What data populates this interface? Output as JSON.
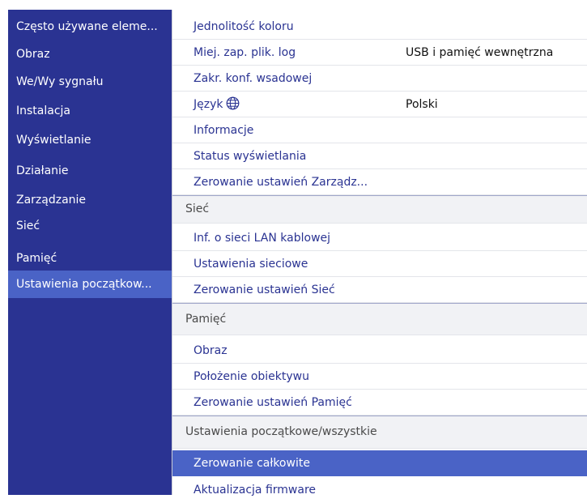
{
  "sidebar": {
    "items": [
      {
        "label": "Często używane eleme..."
      },
      {
        "label": "Obraz"
      },
      {
        "label": "We/Wy sygnału"
      },
      {
        "label": "Instalacja"
      },
      {
        "label": "Wyświetlanie"
      },
      {
        "label": "Działanie"
      },
      {
        "label": "Zarządzanie"
      },
      {
        "label": "Sieć"
      },
      {
        "label": "Pamięć"
      },
      {
        "label": "Ustawienia początkow..."
      }
    ],
    "selected": "Ustawienia początkow..."
  },
  "main": {
    "rows": [
      {
        "label": "Jednolitość koloru"
      },
      {
        "label": "Miej. zap. plik. log",
        "value": "USB i pamięć wewnętrzna"
      },
      {
        "label": "Zakr. konf. wsadowej"
      },
      {
        "label": "Język",
        "value": "Polski",
        "icon": "globe-icon"
      },
      {
        "label": "Informacje"
      },
      {
        "label": "Status wyświetlania"
      },
      {
        "label": "Zerowanie ustawień Zarządz..."
      },
      {
        "label": "Sieć"
      },
      {
        "label": "Inf. o sieci LAN kablowej"
      },
      {
        "label": "Ustawienia sieciowe"
      },
      {
        "label": "Zerowanie ustawień Sieć"
      },
      {
        "label": "Pamięć"
      },
      {
        "label": "Obraz"
      },
      {
        "label": "Położenie obiektywu"
      },
      {
        "label": "Zerowanie ustawień Pamięć"
      },
      {
        "label": "Ustawienia początkowe/wszystkie"
      },
      {
        "label": "Zerowanie całkowite"
      },
      {
        "label": "Aktualizacja firmware"
      }
    ],
    "selected": "Zerowanie całkowite"
  },
  "colors": {
    "sidebar_bg": "#2a3392",
    "highlight": "#4a63c6",
    "item_text": "#2a3392",
    "section_bg": "#f1f2f5"
  }
}
